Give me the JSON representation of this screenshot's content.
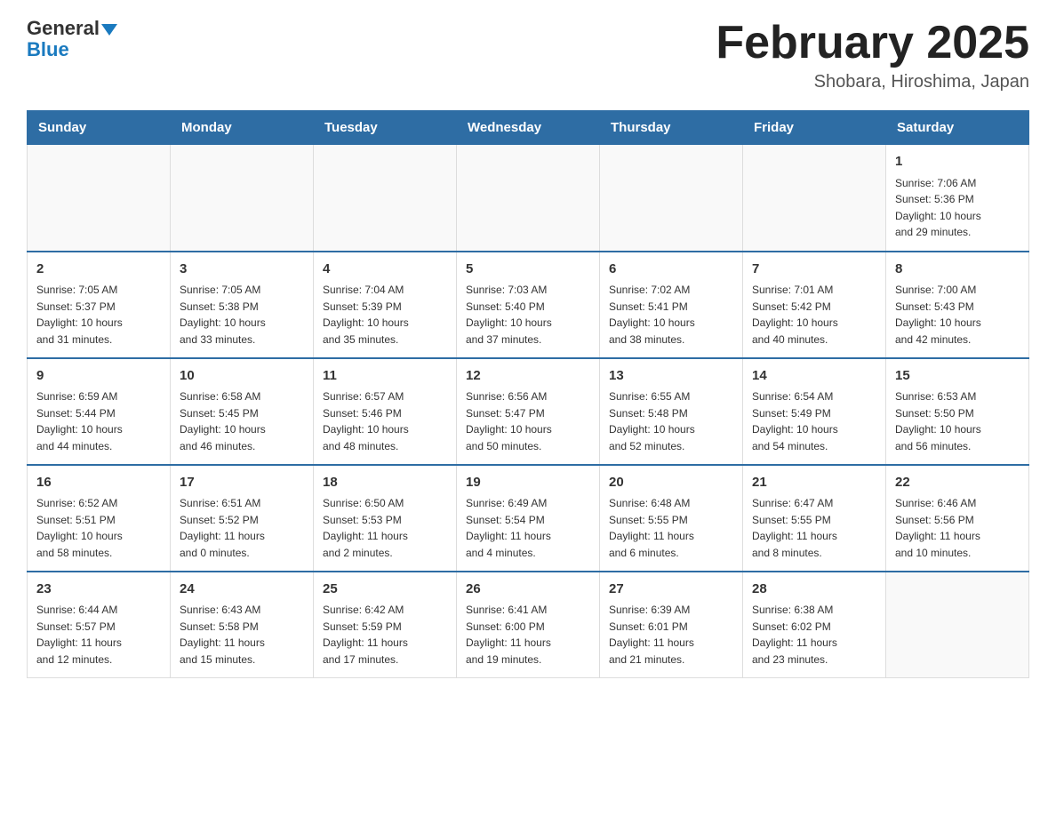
{
  "header": {
    "logo_line1": "General",
    "logo_line2": "Blue",
    "month_title": "February 2025",
    "location": "Shobara, Hiroshima, Japan"
  },
  "days_of_week": [
    "Sunday",
    "Monday",
    "Tuesday",
    "Wednesday",
    "Thursday",
    "Friday",
    "Saturday"
  ],
  "weeks": [
    [
      {
        "day": "",
        "info": ""
      },
      {
        "day": "",
        "info": ""
      },
      {
        "day": "",
        "info": ""
      },
      {
        "day": "",
        "info": ""
      },
      {
        "day": "",
        "info": ""
      },
      {
        "day": "",
        "info": ""
      },
      {
        "day": "1",
        "info": "Sunrise: 7:06 AM\nSunset: 5:36 PM\nDaylight: 10 hours\nand 29 minutes."
      }
    ],
    [
      {
        "day": "2",
        "info": "Sunrise: 7:05 AM\nSunset: 5:37 PM\nDaylight: 10 hours\nand 31 minutes."
      },
      {
        "day": "3",
        "info": "Sunrise: 7:05 AM\nSunset: 5:38 PM\nDaylight: 10 hours\nand 33 minutes."
      },
      {
        "day": "4",
        "info": "Sunrise: 7:04 AM\nSunset: 5:39 PM\nDaylight: 10 hours\nand 35 minutes."
      },
      {
        "day": "5",
        "info": "Sunrise: 7:03 AM\nSunset: 5:40 PM\nDaylight: 10 hours\nand 37 minutes."
      },
      {
        "day": "6",
        "info": "Sunrise: 7:02 AM\nSunset: 5:41 PM\nDaylight: 10 hours\nand 38 minutes."
      },
      {
        "day": "7",
        "info": "Sunrise: 7:01 AM\nSunset: 5:42 PM\nDaylight: 10 hours\nand 40 minutes."
      },
      {
        "day": "8",
        "info": "Sunrise: 7:00 AM\nSunset: 5:43 PM\nDaylight: 10 hours\nand 42 minutes."
      }
    ],
    [
      {
        "day": "9",
        "info": "Sunrise: 6:59 AM\nSunset: 5:44 PM\nDaylight: 10 hours\nand 44 minutes."
      },
      {
        "day": "10",
        "info": "Sunrise: 6:58 AM\nSunset: 5:45 PM\nDaylight: 10 hours\nand 46 minutes."
      },
      {
        "day": "11",
        "info": "Sunrise: 6:57 AM\nSunset: 5:46 PM\nDaylight: 10 hours\nand 48 minutes."
      },
      {
        "day": "12",
        "info": "Sunrise: 6:56 AM\nSunset: 5:47 PM\nDaylight: 10 hours\nand 50 minutes."
      },
      {
        "day": "13",
        "info": "Sunrise: 6:55 AM\nSunset: 5:48 PM\nDaylight: 10 hours\nand 52 minutes."
      },
      {
        "day": "14",
        "info": "Sunrise: 6:54 AM\nSunset: 5:49 PM\nDaylight: 10 hours\nand 54 minutes."
      },
      {
        "day": "15",
        "info": "Sunrise: 6:53 AM\nSunset: 5:50 PM\nDaylight: 10 hours\nand 56 minutes."
      }
    ],
    [
      {
        "day": "16",
        "info": "Sunrise: 6:52 AM\nSunset: 5:51 PM\nDaylight: 10 hours\nand 58 minutes."
      },
      {
        "day": "17",
        "info": "Sunrise: 6:51 AM\nSunset: 5:52 PM\nDaylight: 11 hours\nand 0 minutes."
      },
      {
        "day": "18",
        "info": "Sunrise: 6:50 AM\nSunset: 5:53 PM\nDaylight: 11 hours\nand 2 minutes."
      },
      {
        "day": "19",
        "info": "Sunrise: 6:49 AM\nSunset: 5:54 PM\nDaylight: 11 hours\nand 4 minutes."
      },
      {
        "day": "20",
        "info": "Sunrise: 6:48 AM\nSunset: 5:55 PM\nDaylight: 11 hours\nand 6 minutes."
      },
      {
        "day": "21",
        "info": "Sunrise: 6:47 AM\nSunset: 5:55 PM\nDaylight: 11 hours\nand 8 minutes."
      },
      {
        "day": "22",
        "info": "Sunrise: 6:46 AM\nSunset: 5:56 PM\nDaylight: 11 hours\nand 10 minutes."
      }
    ],
    [
      {
        "day": "23",
        "info": "Sunrise: 6:44 AM\nSunset: 5:57 PM\nDaylight: 11 hours\nand 12 minutes."
      },
      {
        "day": "24",
        "info": "Sunrise: 6:43 AM\nSunset: 5:58 PM\nDaylight: 11 hours\nand 15 minutes."
      },
      {
        "day": "25",
        "info": "Sunrise: 6:42 AM\nSunset: 5:59 PM\nDaylight: 11 hours\nand 17 minutes."
      },
      {
        "day": "26",
        "info": "Sunrise: 6:41 AM\nSunset: 6:00 PM\nDaylight: 11 hours\nand 19 minutes."
      },
      {
        "day": "27",
        "info": "Sunrise: 6:39 AM\nSunset: 6:01 PM\nDaylight: 11 hours\nand 21 minutes."
      },
      {
        "day": "28",
        "info": "Sunrise: 6:38 AM\nSunset: 6:02 PM\nDaylight: 11 hours\nand 23 minutes."
      },
      {
        "day": "",
        "info": ""
      }
    ]
  ]
}
